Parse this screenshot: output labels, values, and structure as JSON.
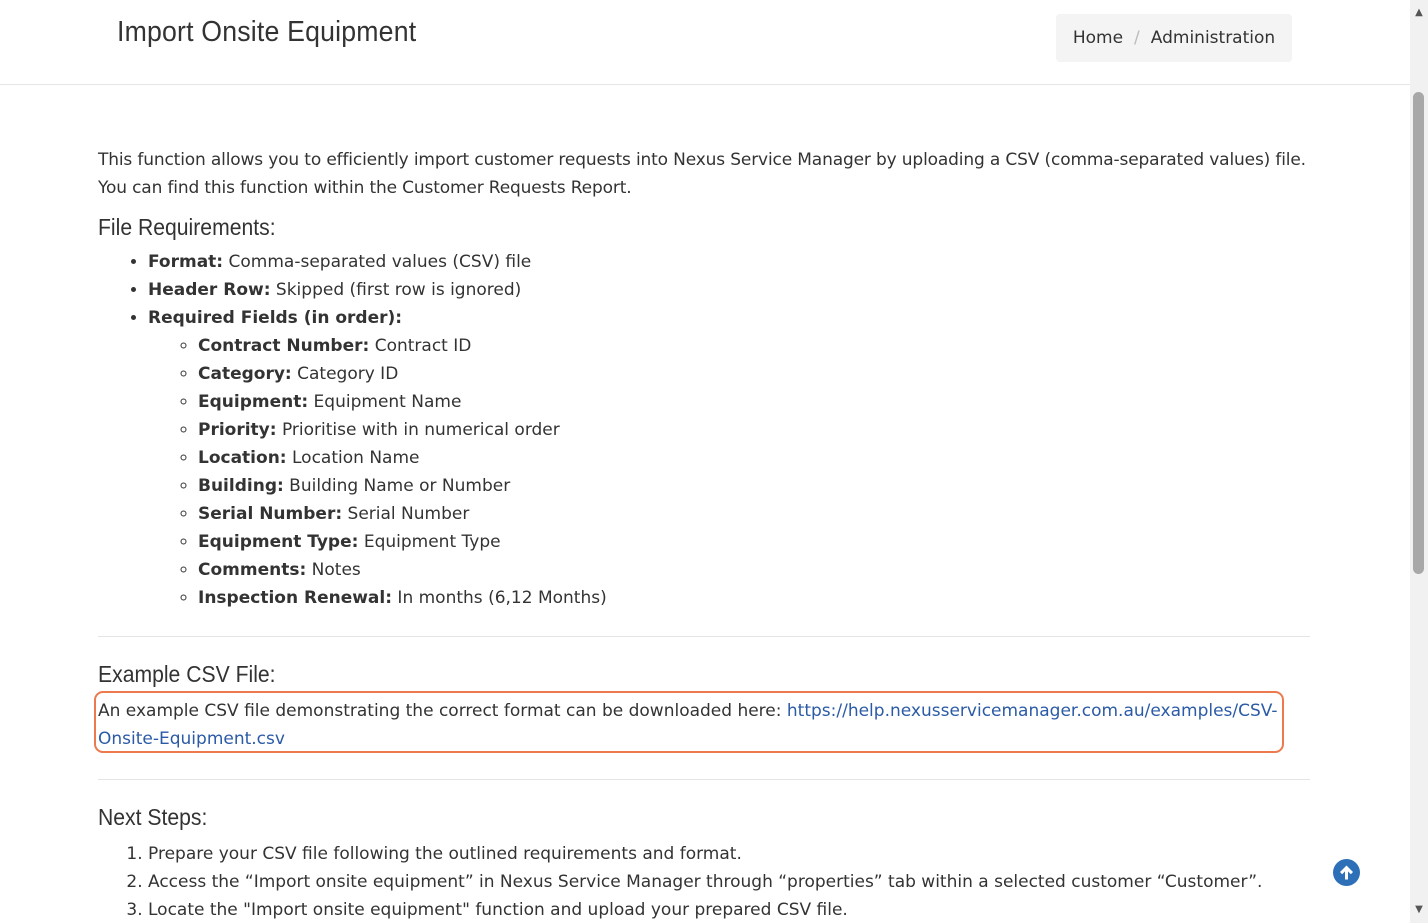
{
  "header": {
    "title": "Import Onsite Equipment",
    "breadcrumb": {
      "home": "Home",
      "separator": "/",
      "current": "Administration"
    }
  },
  "intro": "This function allows you to efficiently import customer requests into Nexus Service Manager by uploading a CSV (comma-separated values) file. You can find this function within the Customer Requests Report.",
  "file_requirements": {
    "heading": "File Requirements:",
    "items": [
      {
        "label": "Format:",
        "value": " Comma-separated values (CSV) file"
      },
      {
        "label": "Header Row:",
        "value": " Skipped (first row is ignored)"
      },
      {
        "label": "Required Fields (in order):",
        "value": ""
      }
    ],
    "fields": [
      {
        "label": "Contract Number:",
        "value": " Contract ID"
      },
      {
        "label": "Category:",
        "value": " Category ID"
      },
      {
        "label": "Equipment:",
        "value": " Equipment Name"
      },
      {
        "label": "Priority:",
        "value": " Prioritise with in numerical order"
      },
      {
        "label": "Location:",
        "value": " Location Name"
      },
      {
        "label": "Building:",
        "value": " Building Name or Number"
      },
      {
        "label": "Serial Number:",
        "value": " Serial Number"
      },
      {
        "label": "Equipment Type:",
        "value": " Equipment Type"
      },
      {
        "label": "Comments:",
        "value": " Notes"
      },
      {
        "label": "Inspection Renewal:",
        "value": " In months (6,12 Months)"
      }
    ]
  },
  "example": {
    "heading": "Example CSV File:",
    "text": "An example CSV file demonstrating the correct format can be downloaded here: ",
    "link": "https://help.nexusservicemanager.com.au/examples/CSV-Onsite-Equipment.csv",
    "highlight_color": "#ec7a4e"
  },
  "next_steps": {
    "heading": "Next Steps:",
    "items": [
      "Prepare your CSV file following the outlined requirements and format.",
      "Access the “Import onsite equipment” in Nexus Service Manager through “properties” tab within a selected customer “Customer”.",
      "Locate the \"Import onsite equipment\" function and upload your prepared CSV file."
    ]
  },
  "icons": {
    "back_to_top": "arrow-up-circle-icon",
    "scroll_up": "triangle-up-icon",
    "scroll_down": "triangle-down-icon"
  },
  "colors": {
    "link": "#2b5aa6",
    "back_to_top": "#2e70b8"
  }
}
